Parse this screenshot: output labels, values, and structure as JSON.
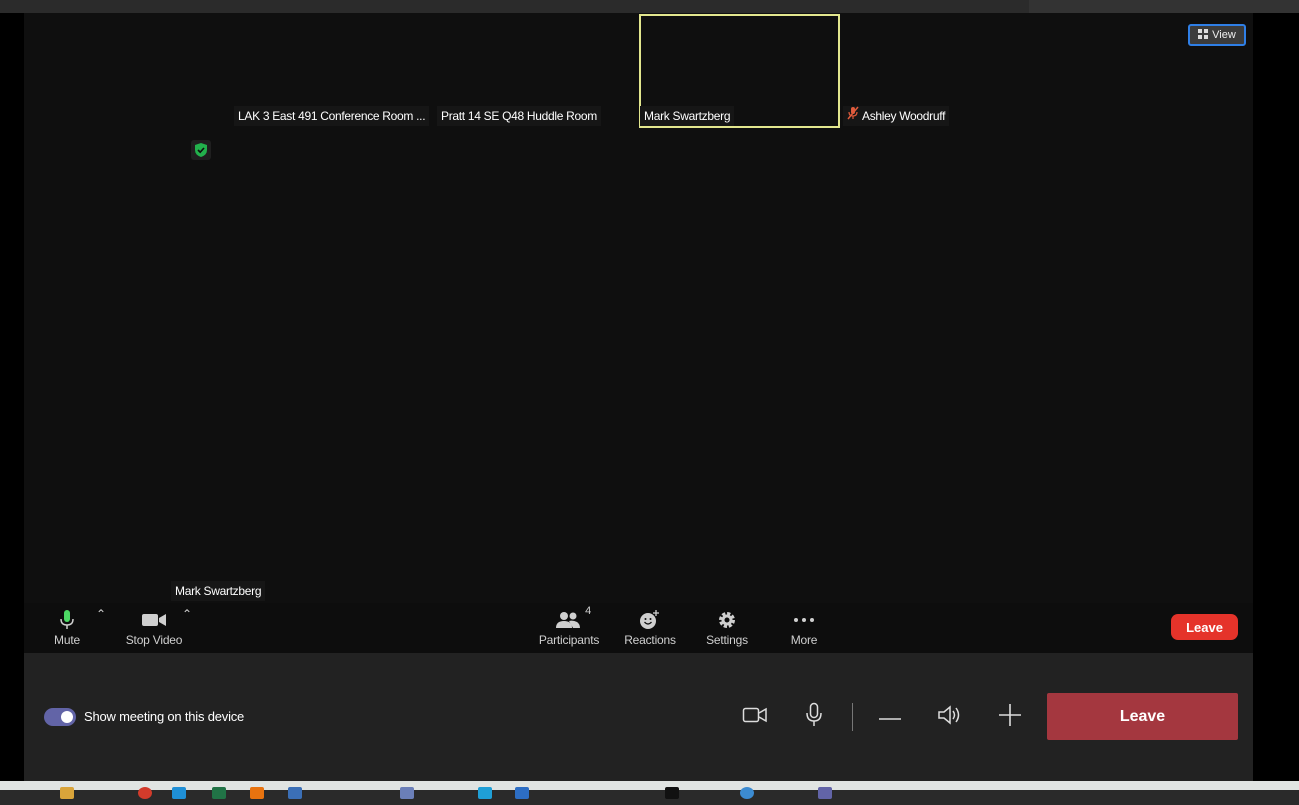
{
  "gallery": {
    "view_label": "View",
    "participants": [
      {
        "name": "LAK 3 East 491 Conference Room ..."
      },
      {
        "name": "Pratt 14 SE Q48 Huddle Room"
      },
      {
        "name": "Mark Swartzberg"
      },
      {
        "name": "Ashley Woodruff"
      }
    ],
    "self_name": "Mark Swartzberg"
  },
  "toolbar": {
    "mute": "Mute",
    "stop_video": "Stop Video",
    "participants": "Participants",
    "participants_count": "4",
    "reactions": "Reactions",
    "settings": "Settings",
    "more": "More",
    "leave": "Leave"
  },
  "device_panel": {
    "show_meeting_label": "Show meeting on this device",
    "leave": "Leave"
  },
  "colors": {
    "accent_blue": "#2f7fe6",
    "active_speaker": "#e2e68e",
    "leave_red": "#e5332a",
    "leave_panel": "#a4373f",
    "toggle_purple": "#6264a7"
  }
}
